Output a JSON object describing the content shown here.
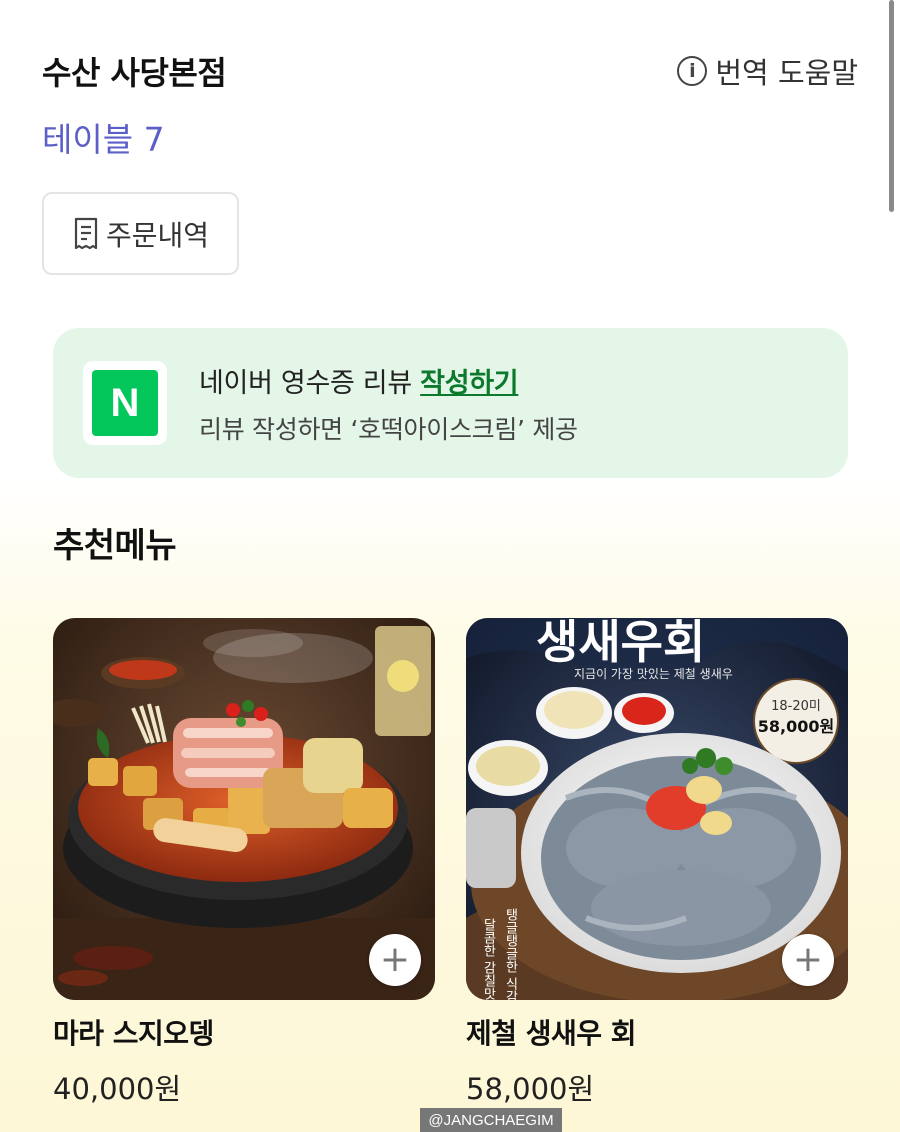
{
  "header": {
    "store_name": "수산 사당본점",
    "help_label": "번역 도움말",
    "table_label": "테이블 7"
  },
  "order_history": {
    "label": "주문내역"
  },
  "review_banner": {
    "line1_prefix": "네이버 영수증 리뷰 ",
    "line1_link": "작성하기",
    "line2": "리뷰 작성하면 ‘호떡아이스크림’ 제공",
    "logo_letter": "N",
    "brand_color": "#03c75a"
  },
  "recommended": {
    "title": "추천메뉴",
    "items": [
      {
        "name": "마라 스지오뎅",
        "price": "40,000원",
        "image": "mala-stew-photo"
      },
      {
        "name": "제철 생새우 회",
        "price": "58,000원",
        "image": "raw-shrimp-photo",
        "image_text": {
          "headline": "생새우회",
          "tagline": "지금이 가장 맛있는 제철 생새우",
          "badge_count": "18-20미",
          "badge_price": "58,000원",
          "vertical_left": "달콤한 감칠맛",
          "vertical_right": "탱글탱글한 식감"
        }
      }
    ]
  },
  "watermark": "@JANGCHAEGIM",
  "colors": {
    "accent": "#5b5fc7",
    "banner_bg": "#e3f6e8",
    "link": "#0b7a2c"
  }
}
